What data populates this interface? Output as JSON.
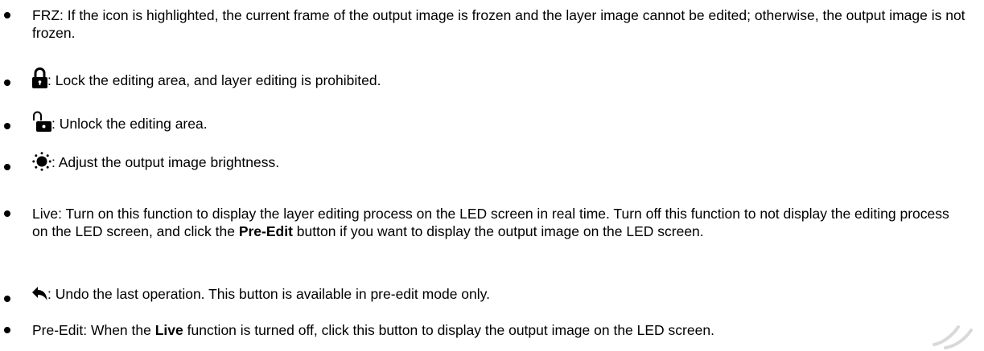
{
  "items": [
    {
      "text": "FRZ: If the icon is highlighted, the current frame of the output image is frozen and the layer image cannot be edited; otherwise, the output image is not frozen."
    },
    {
      "icon": "lock-icon",
      "text": ": Lock the editing area, and layer editing is prohibited."
    },
    {
      "icon": "unlock-icon",
      "text": ": Unlock the editing area."
    },
    {
      "icon": "brightness-icon",
      "text": ": Adjust the output image brightness."
    },
    {
      "text_a": "Live: Turn on this function to display the layer editing process on the LED screen in real time. Turn off this function to not display the editing process on the LED screen, and click the ",
      "bold": "Pre-Edit",
      "text_b": " button if you want to display the output image on the LED screen."
    },
    {
      "icon": "undo-icon",
      "text": ": Undo the last operation. This button is available in pre-edit mode only."
    },
    {
      "text_a": "Pre-Edit: When the ",
      "bold": "Live",
      "text_b": " function is turned off, click this button to display the output image on the LED screen."
    }
  ],
  "colors": {
    "text": "#000000",
    "watermark": "#d9d9d9"
  }
}
